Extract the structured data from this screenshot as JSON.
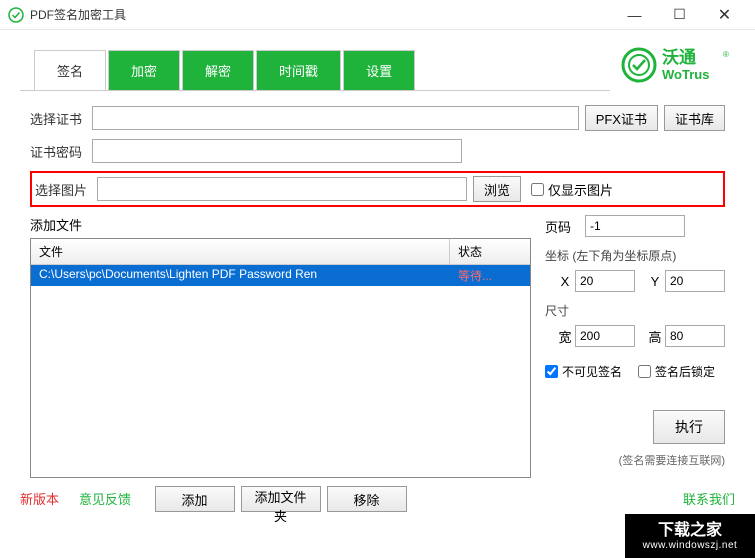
{
  "titlebar": {
    "title": "PDF签名加密工具"
  },
  "tabs": [
    "签名",
    "加密",
    "解密",
    "时间戳",
    "设置"
  ],
  "logo": {
    "cn": "沃通",
    "en": "WoTrus"
  },
  "form": {
    "cert_label": "选择证书",
    "cert_value": "",
    "pfx_btn": "PFX证书",
    "cert_store_btn": "证书库",
    "pwd_label": "证书密码",
    "pwd_value": "",
    "img_label": "选择图片",
    "img_value": "",
    "browse_btn": "浏览",
    "only_show_img": "仅显示图片"
  },
  "files": {
    "label": "添加文件",
    "col_file": "文件",
    "col_status": "状态",
    "rows": [
      {
        "path": "C:\\Users\\pc\\Documents\\Lighten PDF Password Ren",
        "status": "等待..."
      }
    ],
    "add_btn": "添加",
    "add_folder_btn": "添加文件夹",
    "remove_btn": "移除"
  },
  "side": {
    "page_label": "页码",
    "page_value": "-1",
    "coord_label": "坐标",
    "coord_note": "(左下角为坐标原点)",
    "x_label": "X",
    "x_value": "20",
    "y_label": "Y",
    "y_value": "20",
    "size_label": "尺寸",
    "w_label": "宽",
    "w_value": "200",
    "h_label": "高",
    "h_value": "80",
    "invisible_sig": "不可见签名",
    "lock_after_sig": "签名后锁定",
    "exec_btn": "执行",
    "sig_note": "(签名需要连接互联网)"
  },
  "footer": {
    "new_version": "新版本",
    "feedback": "意见反馈",
    "contact": "联系我们"
  },
  "watermark": {
    "cn": "下载之家",
    "url": "www.windowszj.net"
  }
}
